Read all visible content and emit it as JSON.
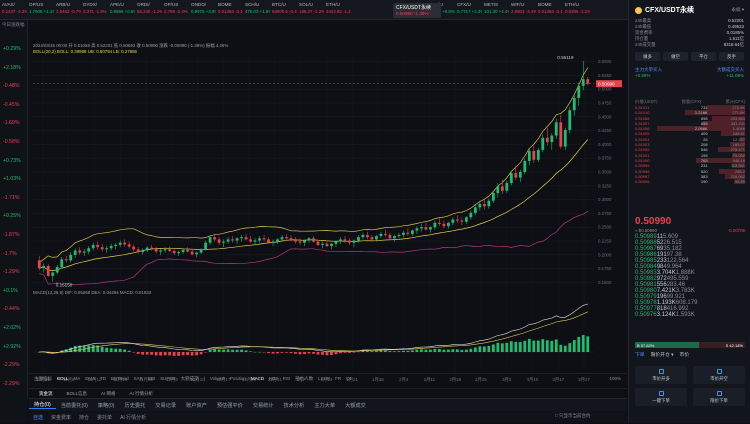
{
  "ticker_bar": [
    {
      "name": "AVAX/",
      "price": "0.1437",
      "change": "-2.3%",
      "dir": "dn"
    },
    {
      "name": "OP/US",
      "price": "1.7606",
      "change": "+1.1%",
      "dir": "up"
    },
    {
      "name": "ARB/U",
      "price": "1.6463",
      "change": "-0.7%",
      "dir": "dn"
    },
    {
      "name": "DYDX/",
      "price": "3.371",
      "change": "-1.9%",
      "dir": "dn"
    },
    {
      "name": "APE/U",
      "price": "0.9896",
      "change": "+0.5%",
      "dir": "up"
    },
    {
      "name": "ORDI/",
      "price": "55.246",
      "change": "-1.2%",
      "dir": "dn"
    },
    {
      "name": "OP/US",
      "price": "2.789",
      "change": "-2.4%",
      "dir": "dn"
    },
    {
      "name": "ONDO/",
      "price": "0.8976",
      "change": "+3.8%",
      "dir": "up"
    },
    {
      "name": "BOME",
      "price": "0.01383",
      "change": "-3.1%",
      "dir": "dn"
    },
    {
      "name": "SCH/U",
      "price": "476.03",
      "change": "+1.8%",
      "dir": "up"
    },
    {
      "name": "BTC/U",
      "price": "66900.6",
      "change": "-0.4%",
      "dir": "dn"
    },
    {
      "name": "SOL/U",
      "price": "188.37",
      "change": "-2.2%",
      "dir": "dn"
    },
    {
      "name": "ETH/U",
      "price": "3442.82",
      "change": "-1.1%",
      "dir": "dn"
    },
    {
      "name": "CFX/USDT永续",
      "price": "0.50990",
      "change": "-1.38%",
      "dir": "dn",
      "active": true
    },
    {
      "name": "DOGE/",
      "price": "0.1936",
      "change": "-1.6%",
      "dir": "dn"
    },
    {
      "name": "LTC/U",
      "price": "91.86",
      "change": "+0.8%",
      "dir": "up"
    },
    {
      "name": "CFX/U",
      "price": "0.7717",
      "change": "+2.3%",
      "dir": "up"
    },
    {
      "name": "METIS",
      "price": "101.30",
      "change": "+4.4%",
      "dir": "up"
    },
    {
      "name": "WIF/U",
      "price": "2.6803",
      "change": "-3.4%",
      "dir": "dn"
    },
    {
      "name": "BOME",
      "price": "0.01383",
      "change": "-3.1%",
      "dir": "dn"
    },
    {
      "name": "ETH/U",
      "price": "0.0286",
      "change": "-2.1%",
      "dir": "dn"
    }
  ],
  "left_column": {
    "header": "今日涨跌幅",
    "changes": [
      {
        "text": "+0.29%",
        "dir": "up"
      },
      {
        "text": "+2.18%",
        "dir": "up"
      },
      {
        "text": "-0.48%",
        "dir": "dn"
      },
      {
        "text": "-0.45%",
        "dir": "dn"
      },
      {
        "text": "-1.69%",
        "dir": "dn"
      },
      {
        "text": "-0.58%",
        "dir": "dn"
      },
      {
        "text": "+0.73%",
        "dir": "up"
      },
      {
        "text": "+1.03%",
        "dir": "up"
      },
      {
        "text": "-1.71%",
        "dir": "dn"
      },
      {
        "text": "+0.25%",
        "dir": "up"
      },
      {
        "text": "-1.87%",
        "dir": "dn"
      },
      {
        "text": "-1.7%",
        "dir": "dn"
      },
      {
        "text": "-1.29%",
        "dir": "dn"
      },
      {
        "text": "+0.1%",
        "dir": "up"
      },
      {
        "text": "-0.44%",
        "dir": "dn"
      },
      {
        "text": "+2.02%",
        "dir": "up"
      },
      {
        "text": "+2.92%",
        "dir": "up"
      },
      {
        "text": "-2.29%",
        "dir": "dn"
      },
      {
        "text": "-2.29%",
        "dir": "dn"
      },
      {
        "text": "+0.1%",
        "dir": "up"
      },
      {
        "text": "+0.47%",
        "dir": "up"
      }
    ]
  },
  "toolbar": {
    "items": [
      "分时",
      "自选",
      "关注",
      "⊕分析",
      "⊞指标",
      "⊖",
      "✎",
      "↺",
      "十字",
      "大",
      "筹",
      "画",
      "▤",
      "▦",
      "⊕",
      "▾"
    ],
    "timeframes": [
      "1分",
      "3分",
      "5分",
      "15分",
      "30分",
      "1时",
      "2时",
      "4时",
      "6时",
      "8时",
      "12时",
      "1日",
      "3日",
      "1周",
      "1月"
    ],
    "active_timeframe": "1日"
  },
  "legend": {
    "line1": "2024/03/25 00:00  开 0.51058  高 0.52201  低 0.50692  收 0.50990  涨跌 -0.00890 (-1.38%)  振幅 4.26%",
    "line2": "BOLL(20,2)  BOLL: 0.39988  UB: 0.50794  LB: 0.27886"
  },
  "macd_label": "MACD(12,26,9)  DIF: 0.05268  DEA: 0.04294  MACD: 0.01933",
  "chart_data": {
    "type": "candlestick",
    "title": "",
    "x_labels": [
      "10月29",
      "11月5",
      "11月12",
      "11月19",
      "11月26",
      "12月3",
      "12月10",
      "12月17",
      "12月24",
      "12月31",
      "1月7",
      "1月14",
      "1月21",
      "1月28",
      "2月4",
      "2月11",
      "2月18",
      "2月25",
      "3月3",
      "3月10",
      "3月17",
      "3月27"
    ],
    "y_ticks": [
      0.55,
      0.525,
      0.5,
      0.475,
      0.45,
      0.425,
      0.4,
      0.375,
      0.35,
      0.325,
      0.3,
      0.275,
      0.25,
      0.225,
      0.2,
      0.175,
      0.15
    ],
    "ylim": [
      0.14,
      0.56
    ],
    "high_marker": "0.55119",
    "low_marker": "0.15150",
    "last_price": "0.50990",
    "ohlc": [
      [
        0.19,
        0.198,
        0.172,
        0.176
      ],
      [
        0.176,
        0.184,
        0.168,
        0.18
      ],
      [
        0.18,
        0.183,
        0.16,
        0.162
      ],
      [
        0.162,
        0.17,
        0.152,
        0.168
      ],
      [
        0.168,
        0.182,
        0.165,
        0.178
      ],
      [
        0.178,
        0.196,
        0.175,
        0.192
      ],
      [
        0.192,
        0.198,
        0.186,
        0.19
      ],
      [
        0.19,
        0.205,
        0.186,
        0.2
      ],
      [
        0.2,
        0.212,
        0.195,
        0.208
      ],
      [
        0.208,
        0.214,
        0.2,
        0.204
      ],
      [
        0.204,
        0.21,
        0.198,
        0.206
      ],
      [
        0.206,
        0.216,
        0.202,
        0.212
      ],
      [
        0.212,
        0.222,
        0.208,
        0.218
      ],
      [
        0.218,
        0.224,
        0.21,
        0.214
      ],
      [
        0.214,
        0.22,
        0.206,
        0.21
      ],
      [
        0.21,
        0.216,
        0.204,
        0.212
      ],
      [
        0.212,
        0.22,
        0.208,
        0.216
      ],
      [
        0.216,
        0.222,
        0.21,
        0.218
      ],
      [
        0.218,
        0.226,
        0.214,
        0.222
      ],
      [
        0.222,
        0.228,
        0.215,
        0.219
      ],
      [
        0.219,
        0.224,
        0.212,
        0.215
      ],
      [
        0.215,
        0.219,
        0.206,
        0.21
      ],
      [
        0.21,
        0.214,
        0.202,
        0.205
      ],
      [
        0.205,
        0.212,
        0.2,
        0.208
      ],
      [
        0.208,
        0.216,
        0.205,
        0.213
      ],
      [
        0.213,
        0.218,
        0.208,
        0.211
      ],
      [
        0.211,
        0.214,
        0.203,
        0.206
      ],
      [
        0.206,
        0.211,
        0.2,
        0.208
      ],
      [
        0.208,
        0.214,
        0.204,
        0.21
      ],
      [
        0.21,
        0.215,
        0.205,
        0.207
      ],
      [
        0.207,
        0.211,
        0.2,
        0.203
      ],
      [
        0.203,
        0.208,
        0.198,
        0.205
      ],
      [
        0.205,
        0.212,
        0.202,
        0.209
      ],
      [
        0.209,
        0.214,
        0.204,
        0.206
      ],
      [
        0.206,
        0.21,
        0.199,
        0.201
      ],
      [
        0.201,
        0.206,
        0.196,
        0.204
      ],
      [
        0.204,
        0.212,
        0.202,
        0.21
      ],
      [
        0.21,
        0.226,
        0.208,
        0.222
      ],
      [
        0.222,
        0.236,
        0.218,
        0.232
      ],
      [
        0.232,
        0.238,
        0.224,
        0.228
      ],
      [
        0.228,
        0.232,
        0.218,
        0.222
      ],
      [
        0.222,
        0.228,
        0.214,
        0.224
      ],
      [
        0.224,
        0.232,
        0.22,
        0.228
      ],
      [
        0.228,
        0.234,
        0.222,
        0.226
      ],
      [
        0.226,
        0.232,
        0.22,
        0.23
      ],
      [
        0.23,
        0.236,
        0.224,
        0.232
      ],
      [
        0.232,
        0.238,
        0.226,
        0.228
      ],
      [
        0.228,
        0.234,
        0.222,
        0.224
      ],
      [
        0.224,
        0.23,
        0.218,
        0.226
      ],
      [
        0.226,
        0.234,
        0.222,
        0.23
      ],
      [
        0.23,
        0.236,
        0.224,
        0.228
      ],
      [
        0.228,
        0.232,
        0.22,
        0.222
      ],
      [
        0.222,
        0.228,
        0.216,
        0.224
      ],
      [
        0.224,
        0.23,
        0.22,
        0.228
      ],
      [
        0.228,
        0.236,
        0.224,
        0.232
      ],
      [
        0.232,
        0.238,
        0.226,
        0.23
      ],
      [
        0.23,
        0.236,
        0.224,
        0.226
      ],
      [
        0.226,
        0.232,
        0.22,
        0.224
      ],
      [
        0.224,
        0.23,
        0.218,
        0.222
      ],
      [
        0.222,
        0.228,
        0.216,
        0.226
      ],
      [
        0.226,
        0.232,
        0.222,
        0.23
      ],
      [
        0.23,
        0.234,
        0.222,
        0.224
      ],
      [
        0.224,
        0.228,
        0.216,
        0.218
      ],
      [
        0.218,
        0.224,
        0.212,
        0.22
      ],
      [
        0.22,
        0.226,
        0.214,
        0.216
      ],
      [
        0.216,
        0.222,
        0.21,
        0.22
      ],
      [
        0.22,
        0.226,
        0.214,
        0.224
      ],
      [
        0.224,
        0.232,
        0.22,
        0.228
      ],
      [
        0.228,
        0.234,
        0.222,
        0.226
      ],
      [
        0.226,
        0.23,
        0.218,
        0.222
      ],
      [
        0.222,
        0.228,
        0.214,
        0.226
      ],
      [
        0.226,
        0.236,
        0.222,
        0.232
      ],
      [
        0.232,
        0.24,
        0.228,
        0.236
      ],
      [
        0.236,
        0.242,
        0.228,
        0.232
      ],
      [
        0.232,
        0.236,
        0.224,
        0.228
      ],
      [
        0.228,
        0.236,
        0.224,
        0.234
      ],
      [
        0.234,
        0.242,
        0.23,
        0.238
      ],
      [
        0.238,
        0.246,
        0.232,
        0.236
      ],
      [
        0.236,
        0.24,
        0.226,
        0.23
      ],
      [
        0.23,
        0.236,
        0.224,
        0.234
      ],
      [
        0.234,
        0.24,
        0.23,
        0.236
      ],
      [
        0.236,
        0.244,
        0.232,
        0.24
      ],
      [
        0.24,
        0.248,
        0.234,
        0.238
      ],
      [
        0.238,
        0.246,
        0.234,
        0.244
      ],
      [
        0.244,
        0.252,
        0.238,
        0.248
      ],
      [
        0.248,
        0.256,
        0.242,
        0.25
      ],
      [
        0.25,
        0.258,
        0.244,
        0.246
      ],
      [
        0.246,
        0.252,
        0.24,
        0.25
      ],
      [
        0.25,
        0.262,
        0.246,
        0.258
      ],
      [
        0.258,
        0.266,
        0.252,
        0.256
      ],
      [
        0.256,
        0.262,
        0.248,
        0.252
      ],
      [
        0.252,
        0.26,
        0.248,
        0.258
      ],
      [
        0.258,
        0.268,
        0.254,
        0.264
      ],
      [
        0.264,
        0.272,
        0.258,
        0.262
      ],
      [
        0.262,
        0.268,
        0.254,
        0.26
      ],
      [
        0.26,
        0.27,
        0.256,
        0.268
      ],
      [
        0.268,
        0.28,
        0.264,
        0.276
      ],
      [
        0.276,
        0.29,
        0.272,
        0.286
      ],
      [
        0.286,
        0.298,
        0.28,
        0.292
      ],
      [
        0.292,
        0.3,
        0.282,
        0.288
      ],
      [
        0.288,
        0.302,
        0.284,
        0.298
      ],
      [
        0.298,
        0.316,
        0.294,
        0.312
      ],
      [
        0.312,
        0.33,
        0.304,
        0.324
      ],
      [
        0.324,
        0.336,
        0.31,
        0.316
      ],
      [
        0.316,
        0.334,
        0.312,
        0.33
      ],
      [
        0.33,
        0.352,
        0.326,
        0.348
      ],
      [
        0.348,
        0.362,
        0.336,
        0.34
      ],
      [
        0.34,
        0.354,
        0.332,
        0.35
      ],
      [
        0.35,
        0.374,
        0.346,
        0.37
      ],
      [
        0.37,
        0.392,
        0.362,
        0.388
      ],
      [
        0.388,
        0.398,
        0.366,
        0.372
      ],
      [
        0.372,
        0.394,
        0.368,
        0.39
      ],
      [
        0.39,
        0.418,
        0.386,
        0.412
      ],
      [
        0.412,
        0.43,
        0.398,
        0.404
      ],
      [
        0.404,
        0.42,
        0.39,
        0.416
      ],
      [
        0.416,
        0.446,
        0.41,
        0.44
      ],
      [
        0.44,
        0.454,
        0.392,
        0.396
      ],
      [
        0.396,
        0.43,
        0.39,
        0.426
      ],
      [
        0.426,
        0.468,
        0.42,
        0.462
      ],
      [
        0.462,
        0.49,
        0.452,
        0.484
      ],
      [
        0.484,
        0.512,
        0.47,
        0.506
      ],
      [
        0.506,
        0.551,
        0.498,
        0.518
      ],
      [
        0.518,
        0.522,
        0.507,
        0.5099
      ]
    ]
  },
  "bottom_tool": {
    "items": [
      "主图指标",
      "BOLL",
      "MA",
      "EMA",
      "TD",
      "BBTrend",
      "SAR",
      "BBI",
      "SUPER",
      "大额成交",
      "|",
      "Volume",
      "Position",
      "MACD",
      "KDJ",
      "RSI",
      "持仓人数",
      "LSUR",
      "FR",
      "OI"
    ],
    "active": [
      "BOLL",
      "MACD"
    ],
    "zoom": "100%"
  },
  "strip": {
    "items": [
      "资金流",
      "BOLL信息",
      "AI 网格",
      "AI 行情分析"
    ],
    "active": "资金流"
  },
  "tabs": {
    "items": [
      "持仓(0)",
      "当前委托(0)",
      "策略(0)",
      "历史委托",
      "交易记录",
      "账户资产",
      "预估强平价",
      "交易统计",
      "技术分析",
      "主力大单",
      "大额成交"
    ],
    "active": "持仓(0)"
  },
  "orders": {
    "items": [
      "自选",
      "资金费率",
      "持仓",
      "委托单",
      "AI 行情分析"
    ],
    "active": "自选",
    "filter": "□ 只显示当前合约"
  },
  "right_panel": {
    "title": "CFX/USDT永续",
    "perp_label": "永续 ▾",
    "info": [
      {
        "k": "24h最高",
        "v": "0.52201"
      },
      {
        "k": "24h最低",
        "v": "0.49523"
      },
      {
        "k": "资金费率",
        "v": "0.0185%"
      },
      {
        "k": "持仓量",
        "v": "1.611亿"
      },
      {
        "k": "24h成交量",
        "v": "8318.64亿"
      }
    ],
    "buttons": [
      "做多",
      "做空",
      "平仓",
      "反手"
    ],
    "section": [
      {
        "k": "主力大单买入",
        "v": "大额成交买入"
      },
      {
        "k": "+0.89%",
        "v": "+11.08%"
      }
    ],
    "book_header": {
      "price": "价格(USDT)",
      "size": "数量(CFX)",
      "total": "累计(CFX)"
    },
    "asks": [
      {
        "p": "0.51011",
        "q": "731",
        "t": "272.4K",
        "w": 0.35
      },
      {
        "p": "0.51010",
        "q": "1.216K",
        "t": "271.6K",
        "w": 0.55
      },
      {
        "p": "0.51008",
        "q": "698",
        "t": "203.553",
        "w": 0.3
      },
      {
        "p": "0.51007",
        "q": "855",
        "t": "441.211",
        "w": 0.38
      },
      {
        "p": "0.51006",
        "q": "2.056K",
        "t": "1.4046",
        "w": 0.8
      },
      {
        "p": "0.51005",
        "q": "409",
        "t": "248.61",
        "w": 0.22
      },
      {
        "p": "0.51004",
        "q": "26",
        "t": "12.257",
        "w": 0.05
      },
      {
        "p": "0.51003",
        "q": "208",
        "t": "165.07",
        "w": 0.14
      },
      {
        "p": "0.51002",
        "q": "546",
        "t": "278.471",
        "w": 0.25
      },
      {
        "p": "0.51001",
        "q": "195",
        "t": "70.032",
        "w": 0.12
      },
      {
        "p": "0.51000",
        "q": "763",
        "t": "946.19",
        "w": 0.45
      },
      {
        "p": "0.50999",
        "q": "231",
        "t": "119.561",
        "w": 0.12
      },
      {
        "p": "0.50998",
        "q": "520",
        "t": "265.2",
        "w": 0.24
      },
      {
        "p": "0.50997",
        "q": "383",
        "t": "216.062",
        "w": 0.18
      },
      {
        "p": "0.50996",
        "q": "190",
        "t": "96.89",
        "w": 0.1
      }
    ],
    "last_price": "0.50990",
    "last_sub": {
      "left": "≈ $0.50990",
      "right": "-0.00709"
    },
    "bids": [
      {
        "p": "0.50989",
        "q": "11",
        "t": "5.609",
        "w": 0.05
      },
      {
        "p": "0.50988",
        "q": "52",
        "t": "26.515",
        "w": 0.06
      },
      {
        "p": "0.50987",
        "q": "69",
        "t": "35.182",
        "w": 0.07
      },
      {
        "p": "0.50986",
        "q": "191",
        "t": "97.38",
        "w": 0.1
      },
      {
        "p": "0.50985",
        "q": "233",
        "t": "122.564",
        "w": 0.14
      },
      {
        "p": "0.50984",
        "q": "98",
        "t": "49.964",
        "w": 0.08
      },
      {
        "p": "0.50983",
        "q": "3.704K",
        "t": "1.888K",
        "w": 0.95
      },
      {
        "p": "0.50982",
        "q": "972",
        "t": "495.559",
        "w": 0.4
      },
      {
        "p": "0.50981",
        "q": "556",
        "t": "283.46",
        "w": 0.25
      },
      {
        "p": "0.50980",
        "q": "7.421K",
        "t": "3.783K",
        "w": 1.0
      },
      {
        "p": "0.50979",
        "q": "196",
        "t": "99.921",
        "w": 0.1
      },
      {
        "p": "0.50978",
        "q": "1.193K",
        "t": "608.179",
        "w": 0.48
      },
      {
        "p": "0.50977",
        "q": "818",
        "t": "416.992",
        "w": 0.35
      },
      {
        "p": "0.50976",
        "q": "3.124K",
        "t": "1.593K",
        "w": 0.85
      }
    ],
    "ratio": {
      "buy": 0.58,
      "left": "B 57.82%",
      "right": "S 42.18%"
    },
    "foot_tabs": [
      "下单",
      "限价开仓 ▾",
      "市价"
    ],
    "foot_active": "下单",
    "actions": [
      "市价开多",
      "市价开空",
      "一键下单",
      "限价下单"
    ]
  }
}
